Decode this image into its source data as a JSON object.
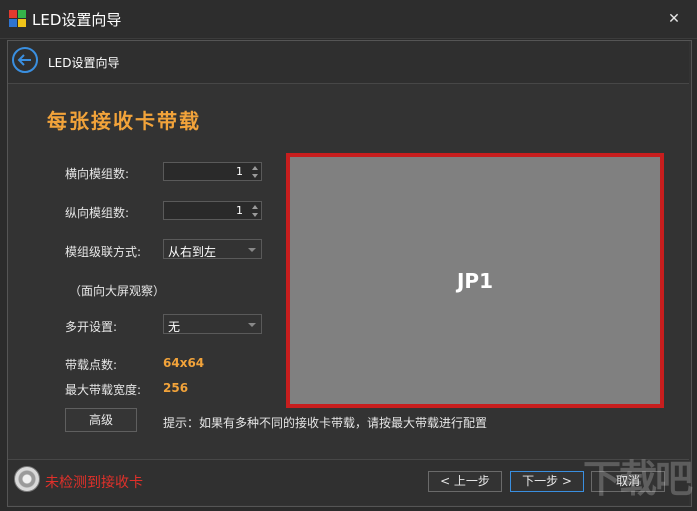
{
  "window": {
    "title": "LED设置向导",
    "close_glyph": "✕",
    "accent": "#3a8fe0"
  },
  "nav": {
    "title": "LED设置向导"
  },
  "page": {
    "heading": "每张接收卡带载"
  },
  "form": {
    "horizontal_modules_label": "横向模组数:",
    "horizontal_modules_value": "1",
    "vertical_modules_label": "纵向模组数:",
    "vertical_modules_value": "1",
    "cascade_label": "模组级联方式:",
    "cascade_value": "从右到左",
    "view_hint": "（面向大屏观察）",
    "multi_open_label": "多开设置:",
    "multi_open_value": "无",
    "load_points_label": "带载点数:",
    "load_points_value": "64x64",
    "max_width_label": "最大带载宽度:",
    "max_width_value": "256",
    "advanced_button": "高级",
    "tip": "提示：如果有多种不同的接收卡带载，请按最大带载进行配置"
  },
  "preview": {
    "label": "JP1",
    "border_color": "#c81e1e",
    "fill_color": "#808080"
  },
  "footer": {
    "status_text": "未检测到接收卡",
    "status_color": "#e0302a",
    "prev_button": "< 上一步",
    "next_button": "下一步 >",
    "cancel_button": "取消",
    "watermark": "下载吧"
  }
}
